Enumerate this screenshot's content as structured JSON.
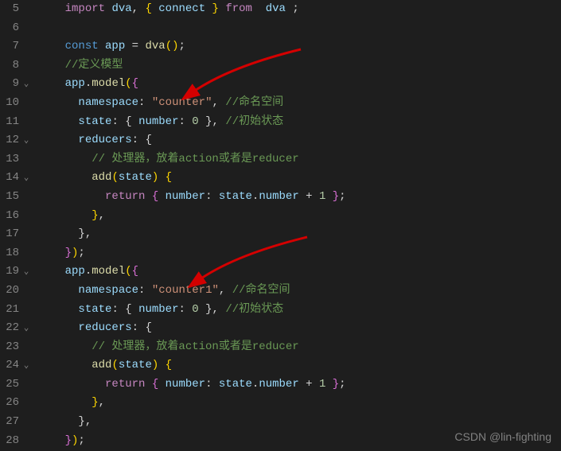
{
  "lines": [
    {
      "num": "5",
      "fold": "",
      "tokens": [
        [
          "c-punc",
          "    "
        ],
        [
          "c-keyword",
          "import"
        ],
        [
          "c-punc",
          " "
        ],
        [
          "c-ident",
          "dva"
        ],
        [
          "c-punc",
          ", "
        ],
        [
          "c-brace-y",
          "{ "
        ],
        [
          "c-ident",
          "connect"
        ],
        [
          "c-brace-y",
          " }"
        ],
        [
          "c-punc",
          " "
        ],
        [
          "c-keyword",
          "from"
        ],
        [
          "c-punc",
          "  "
        ],
        [
          "c-ident",
          "dva"
        ],
        [
          "c-punc",
          " ;"
        ]
      ]
    },
    {
      "num": "6",
      "fold": "",
      "tokens": []
    },
    {
      "num": "7",
      "fold": "",
      "tokens": [
        [
          "c-punc",
          "    "
        ],
        [
          "c-const",
          "const"
        ],
        [
          "c-punc",
          " "
        ],
        [
          "c-ident",
          "app"
        ],
        [
          "c-punc",
          " = "
        ],
        [
          "c-func",
          "dva"
        ],
        [
          "c-brace-y",
          "()"
        ],
        [
          "c-punc",
          ";"
        ]
      ]
    },
    {
      "num": "8",
      "fold": "",
      "tokens": [
        [
          "c-punc",
          "    "
        ],
        [
          "c-comment",
          "//定义模型"
        ]
      ]
    },
    {
      "num": "9",
      "fold": "v",
      "tokens": [
        [
          "c-punc",
          "    "
        ],
        [
          "c-ident",
          "app"
        ],
        [
          "c-punc",
          "."
        ],
        [
          "c-func",
          "model"
        ],
        [
          "c-brace-y",
          "("
        ],
        [
          "c-brace-p",
          "{"
        ]
      ]
    },
    {
      "num": "10",
      "fold": "",
      "tokens": [
        [
          "c-punc",
          "      "
        ],
        [
          "c-ident",
          "namespace"
        ],
        [
          "c-punc",
          ": "
        ],
        [
          "c-string",
          "\"counter\""
        ],
        [
          "c-punc",
          ", "
        ],
        [
          "c-comment",
          "//命名空间"
        ]
      ]
    },
    {
      "num": "11",
      "fold": "",
      "tokens": [
        [
          "c-punc",
          "      "
        ],
        [
          "c-ident",
          "state"
        ],
        [
          "c-punc",
          ": "
        ],
        [
          "c-brace",
          "{ "
        ],
        [
          "c-ident",
          "number"
        ],
        [
          "c-punc",
          ": "
        ],
        [
          "c-number",
          "0"
        ],
        [
          "c-brace",
          " }"
        ],
        [
          "c-punc",
          ", "
        ],
        [
          "c-comment",
          "//初始状态"
        ]
      ]
    },
    {
      "num": "12",
      "fold": "v",
      "tokens": [
        [
          "c-punc",
          "      "
        ],
        [
          "c-ident",
          "reducers"
        ],
        [
          "c-punc",
          ": "
        ],
        [
          "c-brace",
          "{"
        ]
      ]
    },
    {
      "num": "13",
      "fold": "",
      "tokens": [
        [
          "c-punc",
          "        "
        ],
        [
          "c-comment",
          "// 处理器，放着action或者是reducer"
        ]
      ]
    },
    {
      "num": "14",
      "fold": "v",
      "tokens": [
        [
          "c-punc",
          "        "
        ],
        [
          "c-func",
          "add"
        ],
        [
          "c-brace-y",
          "("
        ],
        [
          "c-ident",
          "state"
        ],
        [
          "c-brace-y",
          ")"
        ],
        [
          "c-punc",
          " "
        ],
        [
          "c-brace-y",
          "{"
        ]
      ]
    },
    {
      "num": "15",
      "fold": "",
      "tokens": [
        [
          "c-punc",
          "          "
        ],
        [
          "c-keyword",
          "return"
        ],
        [
          "c-punc",
          " "
        ],
        [
          "c-brace-p",
          "{ "
        ],
        [
          "c-ident",
          "number"
        ],
        [
          "c-punc",
          ": "
        ],
        [
          "c-ident",
          "state"
        ],
        [
          "c-punc",
          "."
        ],
        [
          "c-ident",
          "number"
        ],
        [
          "c-punc",
          " + "
        ],
        [
          "c-number",
          "1"
        ],
        [
          "c-brace-p",
          " }"
        ],
        [
          "c-punc",
          ";"
        ]
      ]
    },
    {
      "num": "16",
      "fold": "",
      "tokens": [
        [
          "c-punc",
          "        "
        ],
        [
          "c-brace-y",
          "}"
        ],
        [
          "c-punc",
          ","
        ]
      ]
    },
    {
      "num": "17",
      "fold": "",
      "tokens": [
        [
          "c-punc",
          "      "
        ],
        [
          "c-brace",
          "}"
        ],
        [
          "c-punc",
          ","
        ]
      ]
    },
    {
      "num": "18",
      "fold": "",
      "tokens": [
        [
          "c-punc",
          "    "
        ],
        [
          "c-brace-p",
          "}"
        ],
        [
          "c-brace-y",
          ")"
        ],
        [
          "c-punc",
          ";"
        ]
      ]
    },
    {
      "num": "19",
      "fold": "v",
      "tokens": [
        [
          "c-punc",
          "    "
        ],
        [
          "c-ident",
          "app"
        ],
        [
          "c-punc",
          "."
        ],
        [
          "c-func",
          "model"
        ],
        [
          "c-brace-y",
          "("
        ],
        [
          "c-brace-p",
          "{"
        ]
      ]
    },
    {
      "num": "20",
      "fold": "",
      "tokens": [
        [
          "c-punc",
          "      "
        ],
        [
          "c-ident",
          "namespace"
        ],
        [
          "c-punc",
          ": "
        ],
        [
          "c-string",
          "\"counter1\""
        ],
        [
          "c-punc",
          ", "
        ],
        [
          "c-comment",
          "//命名空间"
        ]
      ]
    },
    {
      "num": "21",
      "fold": "",
      "tokens": [
        [
          "c-punc",
          "      "
        ],
        [
          "c-ident",
          "state"
        ],
        [
          "c-punc",
          ": "
        ],
        [
          "c-brace",
          "{ "
        ],
        [
          "c-ident",
          "number"
        ],
        [
          "c-punc",
          ": "
        ],
        [
          "c-number",
          "0"
        ],
        [
          "c-brace",
          " }"
        ],
        [
          "c-punc",
          ", "
        ],
        [
          "c-comment",
          "//初始状态"
        ]
      ]
    },
    {
      "num": "22",
      "fold": "v",
      "tokens": [
        [
          "c-punc",
          "      "
        ],
        [
          "c-ident",
          "reducers"
        ],
        [
          "c-punc",
          ": "
        ],
        [
          "c-brace",
          "{"
        ]
      ]
    },
    {
      "num": "23",
      "fold": "",
      "tokens": [
        [
          "c-punc",
          "        "
        ],
        [
          "c-comment",
          "// 处理器，放着action或者是reducer"
        ]
      ]
    },
    {
      "num": "24",
      "fold": "v",
      "tokens": [
        [
          "c-punc",
          "        "
        ],
        [
          "c-func",
          "add"
        ],
        [
          "c-brace-y",
          "("
        ],
        [
          "c-ident",
          "state"
        ],
        [
          "c-brace-y",
          ")"
        ],
        [
          "c-punc",
          " "
        ],
        [
          "c-brace-y",
          "{"
        ]
      ]
    },
    {
      "num": "25",
      "fold": "",
      "tokens": [
        [
          "c-punc",
          "          "
        ],
        [
          "c-keyword",
          "return"
        ],
        [
          "c-punc",
          " "
        ],
        [
          "c-brace-p",
          "{ "
        ],
        [
          "c-ident",
          "number"
        ],
        [
          "c-punc",
          ": "
        ],
        [
          "c-ident",
          "state"
        ],
        [
          "c-punc",
          "."
        ],
        [
          "c-ident",
          "number"
        ],
        [
          "c-punc",
          " + "
        ],
        [
          "c-number",
          "1"
        ],
        [
          "c-brace-p",
          " }"
        ],
        [
          "c-punc",
          ";"
        ]
      ]
    },
    {
      "num": "26",
      "fold": "",
      "tokens": [
        [
          "c-punc",
          "        "
        ],
        [
          "c-brace-y",
          "}"
        ],
        [
          "c-punc",
          ","
        ]
      ]
    },
    {
      "num": "27",
      "fold": "",
      "tokens": [
        [
          "c-punc",
          "      "
        ],
        [
          "c-brace",
          "}"
        ],
        [
          "c-punc",
          ","
        ]
      ]
    },
    {
      "num": "28",
      "fold": "",
      "tokens": [
        [
          "c-punc",
          "    "
        ],
        [
          "c-brace-p",
          "}"
        ],
        [
          "c-brace-y",
          ")"
        ],
        [
          "c-punc",
          ";"
        ]
      ]
    }
  ],
  "watermark": "CSDN @lin-fighting"
}
